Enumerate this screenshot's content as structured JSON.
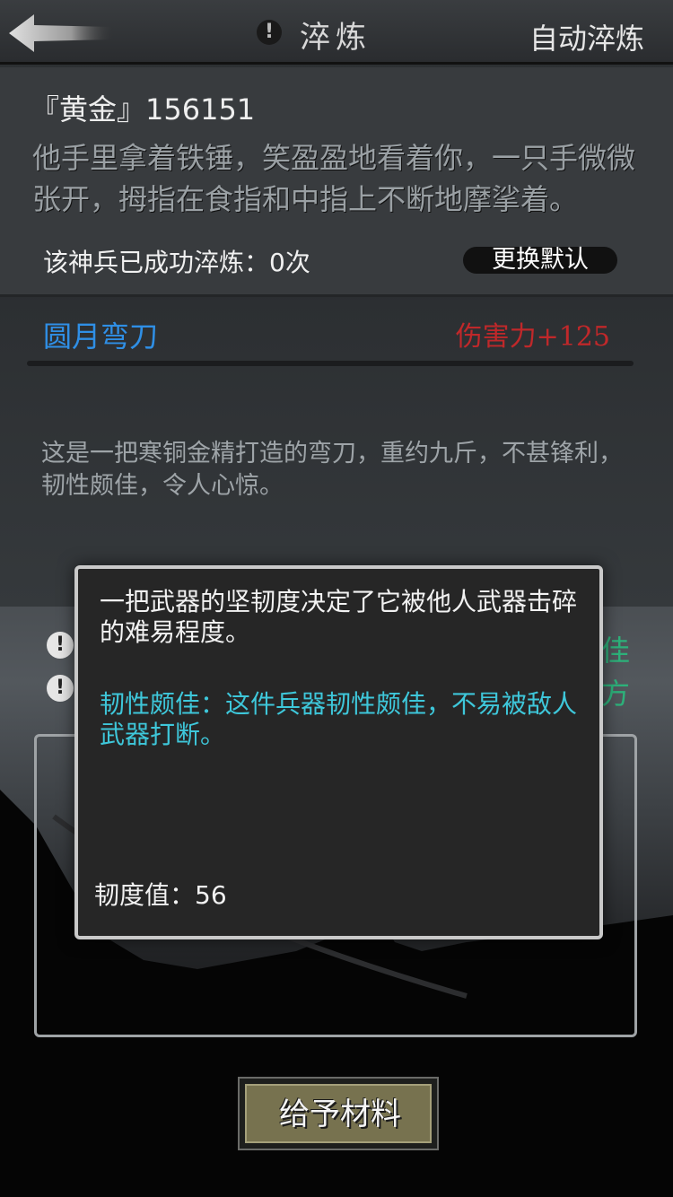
{
  "header": {
    "title": "淬炼",
    "auto_label": "自动淬炼"
  },
  "info": {
    "owner": "『黄金』156151",
    "description": "他手里拿着铁锤，笑盈盈地看着你，一只手微微张开，拇指在食指和中指上不断地摩挲着。",
    "refine_count": "该神兵已成功淬炼：0次",
    "default_label": "更换默认"
  },
  "weapon": {
    "name": "圆月弯刀",
    "damage": "伤害力+125",
    "description": "这是一把寒铜金精打造的弯刀，重约九斤，不甚锋利，韧性颇佳，令人心惊。"
  },
  "attributes": {
    "row1_tail": "佳",
    "row2_tail": "⽅"
  },
  "tooltip": {
    "description": "一把武器的坚韧度决定了它被他人武器击碎的难易程度。",
    "trait": "韧性颇佳：这件兵器韧性颇佳，不易被敌人武器打断。",
    "value": "韧度值：56"
  },
  "actions": {
    "give_label": "给予材料"
  },
  "colors": {
    "weapon_name": "#2f8fe6",
    "damage": "#c0282a",
    "trait": "#3ec7da",
    "button_olive": "#77724f"
  },
  "icons": {
    "back": "back-arrow-icon",
    "alert": "exclamation-icon"
  }
}
